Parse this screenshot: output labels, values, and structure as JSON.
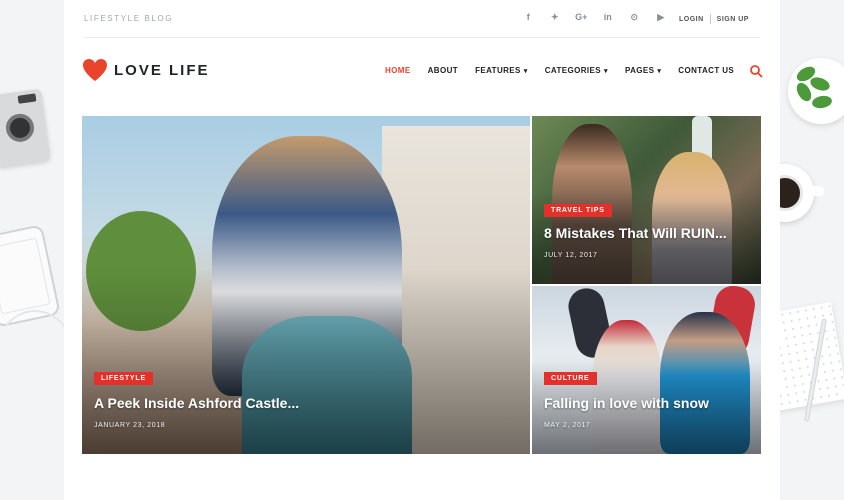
{
  "topbar": {
    "tagline": "LIFESTYLE BLOG",
    "social": [
      {
        "icon": "facebook-icon",
        "glyph": "f"
      },
      {
        "icon": "twitter-icon",
        "glyph": "✦"
      },
      {
        "icon": "google-plus-icon",
        "glyph": "G+"
      },
      {
        "icon": "linkedin-icon",
        "glyph": "in"
      },
      {
        "icon": "pinterest-icon",
        "glyph": "⊙"
      },
      {
        "icon": "youtube-icon",
        "glyph": "▶"
      }
    ],
    "login": "LOGIN",
    "signup": "SIGN UP"
  },
  "brand": {
    "name": "LOVE LIFE",
    "accent": "#e8452c"
  },
  "nav": {
    "items": [
      {
        "label": "HOME",
        "active": true,
        "dropdown": false
      },
      {
        "label": "ABOUT",
        "active": false,
        "dropdown": false
      },
      {
        "label": "FEATURES",
        "active": false,
        "dropdown": true
      },
      {
        "label": "CATEGORIES",
        "active": false,
        "dropdown": true
      },
      {
        "label": "PAGES",
        "active": false,
        "dropdown": true
      },
      {
        "label": "CONTACT US",
        "active": false,
        "dropdown": false
      }
    ],
    "search_icon": "search-icon"
  },
  "posts": [
    {
      "category": "LIFESTYLE",
      "title": "A Peek Inside Ashford Castle...",
      "date": "JANUARY 23, 2018"
    },
    {
      "category": "TRAVEL TIPS",
      "title": "8 Mistakes That Will RUIN...",
      "date": "JULY 12, 2017"
    },
    {
      "category": "CULTURE",
      "title": "Falling in love with snow",
      "date": "MAY 2, 2017"
    }
  ]
}
